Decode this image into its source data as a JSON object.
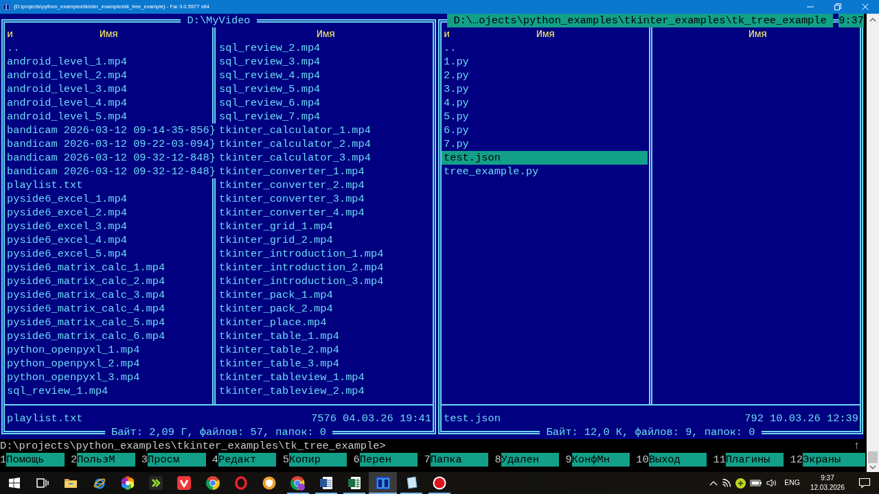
{
  "window": {
    "title": "{D:\\projects\\python_examples\\tkinter_examples\\tk_tree_example} - Far 3.0.5577 x64"
  },
  "panels": [
    {
      "title": "D:\\MyVideo",
      "active": false,
      "sort_indicator": "и",
      "column_headers": [
        "Имя",
        "Имя"
      ],
      "columns": [
        [
          {
            "name": "..",
            "selected": false
          },
          {
            "name": "android_level_1.mp4",
            "selected": false
          },
          {
            "name": "android_level_2.mp4",
            "selected": false
          },
          {
            "name": "android_level_3.mp4",
            "selected": false
          },
          {
            "name": "android_level_4.mp4",
            "selected": false
          },
          {
            "name": "android_level_5.mp4",
            "selected": false
          },
          {
            "name": "bandicam 2026-03-12 09-14-35-856}",
            "selected": false
          },
          {
            "name": "bandicam 2026-03-12 09-22-03-094}",
            "selected": false
          },
          {
            "name": "bandicam 2026-03-12 09-32-12-848}",
            "selected": false
          },
          {
            "name": "bandicam 2026-03-12 09-32-12-848}",
            "selected": false
          },
          {
            "name": "playlist.txt",
            "selected": false
          },
          {
            "name": "pyside6_excel_1.mp4",
            "selected": false
          },
          {
            "name": "pyside6_excel_2.mp4",
            "selected": false
          },
          {
            "name": "pyside6_excel_3.mp4",
            "selected": false
          },
          {
            "name": "pyside6_excel_4.mp4",
            "selected": false
          },
          {
            "name": "pyside6_excel_5.mp4",
            "selected": false
          },
          {
            "name": "pyside6_matrix_calc_1.mp4",
            "selected": false
          },
          {
            "name": "pyside6_matrix_calc_2.mp4",
            "selected": false
          },
          {
            "name": "pyside6_matrix_calc_3.mp4",
            "selected": false
          },
          {
            "name": "pyside6_matrix_calc_4.mp4",
            "selected": false
          },
          {
            "name": "pyside6_matrix_calc_5.mp4",
            "selected": false
          },
          {
            "name": "pyside6_matrix_calc_6.mp4",
            "selected": false
          },
          {
            "name": "python_openpyxl_1.mp4",
            "selected": false
          },
          {
            "name": "python_openpyxl_2.mp4",
            "selected": false
          },
          {
            "name": "python_openpyxl_3.mp4",
            "selected": false
          },
          {
            "name": "sql_review_1.mp4",
            "selected": false
          }
        ],
        [
          {
            "name": "sql_review_2.mp4",
            "selected": false
          },
          {
            "name": "sql_review_3.mp4",
            "selected": false
          },
          {
            "name": "sql_review_4.mp4",
            "selected": false
          },
          {
            "name": "sql_review_5.mp4",
            "selected": false
          },
          {
            "name": "sql_review_6.mp4",
            "selected": false
          },
          {
            "name": "sql_review_7.mp4",
            "selected": false
          },
          {
            "name": "tkinter_calculator_1.mp4",
            "selected": false
          },
          {
            "name": "tkinter_calculator_2.mp4",
            "selected": false
          },
          {
            "name": "tkinter_calculator_3.mp4",
            "selected": false
          },
          {
            "name": "tkinter_converter_1.mp4",
            "selected": false
          },
          {
            "name": "tkinter_converter_2.mp4",
            "selected": false
          },
          {
            "name": "tkinter_converter_3.mp4",
            "selected": false
          },
          {
            "name": "tkinter_converter_4.mp4",
            "selected": false
          },
          {
            "name": "tkinter_grid_1.mp4",
            "selected": false
          },
          {
            "name": "tkinter_grid_2.mp4",
            "selected": false
          },
          {
            "name": "tkinter_introduction_1.mp4",
            "selected": false
          },
          {
            "name": "tkinter_introduction_2.mp4",
            "selected": false
          },
          {
            "name": "tkinter_introduction_3.mp4",
            "selected": false
          },
          {
            "name": "tkinter_pack_1.mp4",
            "selected": false
          },
          {
            "name": "tkinter_pack_2.mp4",
            "selected": false
          },
          {
            "name": "tkinter_place.mp4",
            "selected": false
          },
          {
            "name": "tkinter_table_1.mp4",
            "selected": false
          },
          {
            "name": "tkinter_table_2.mp4",
            "selected": false
          },
          {
            "name": "tkinter_table_3.mp4",
            "selected": false
          },
          {
            "name": "tkinter_tableview_1.mp4",
            "selected": false
          },
          {
            "name": "tkinter_tableview_2.mp4",
            "selected": false
          }
        ]
      ],
      "info": {
        "name": "playlist.txt",
        "details": "7576 04.03.26 19:41"
      },
      "totals": "Байт: 2,09 Г, файлов: 57, папок: 0"
    },
    {
      "title": "D:\\…ojects\\python_examples\\tkinter_examples\\tk_tree_example",
      "active": true,
      "clock": "9:37",
      "sort_indicator": "и",
      "column_headers": [
        "Имя",
        "Имя"
      ],
      "columns": [
        [
          {
            "name": "..",
            "selected": false
          },
          {
            "name": "1.py",
            "selected": false
          },
          {
            "name": "2.py",
            "selected": false
          },
          {
            "name": "3.py",
            "selected": false
          },
          {
            "name": "4.py",
            "selected": false
          },
          {
            "name": "5.py",
            "selected": false
          },
          {
            "name": "6.py",
            "selected": false
          },
          {
            "name": "7.py",
            "selected": false
          },
          {
            "name": "test.json",
            "selected": true
          },
          {
            "name": "tree_example.py",
            "selected": false
          }
        ]
      ],
      "info": {
        "name": "test.json",
        "details": "792 10.03.26 12:39"
      },
      "totals": "Байт: 12,0 К, файлов: 9, папок: 0"
    }
  ],
  "command_line": {
    "text": "D:\\projects\\python_examples\\tkinter_examples\\tk_tree_example>",
    "scroll_marker": "↑"
  },
  "key_bar": [
    {
      "key": "1",
      "label": "Помощь"
    },
    {
      "key": "2",
      "label": "ПользМ"
    },
    {
      "key": "3",
      "label": "Просм"
    },
    {
      "key": "4",
      "label": "Редакт"
    },
    {
      "key": "5",
      "label": "Копир"
    },
    {
      "key": "6",
      "label": "Перен"
    },
    {
      "key": "7",
      "label": "Папка"
    },
    {
      "key": "8",
      "label": "Удален"
    },
    {
      "key": "9",
      "label": "КонфМн"
    },
    {
      "key": "10",
      "label": "Выход"
    },
    {
      "key": "11",
      "label": "Плагины"
    },
    {
      "key": "12",
      "label": "Экраны"
    }
  ],
  "taskbar": {
    "apps": [
      {
        "kind": "start",
        "running": false,
        "selected": false
      },
      {
        "kind": "task_view",
        "running": false,
        "selected": false
      },
      {
        "kind": "folder",
        "running": false,
        "selected": false
      },
      {
        "kind": "e_browser",
        "running": false,
        "selected": false
      },
      {
        "kind": "color_wheel",
        "running": false,
        "selected": false
      },
      {
        "kind": "app_tile",
        "running": false,
        "selected": false
      },
      {
        "kind": "v_tile",
        "running": false,
        "selected": false
      },
      {
        "kind": "color_ring",
        "running": false,
        "selected": false
      },
      {
        "kind": "o_ring",
        "running": false,
        "selected": false
      },
      {
        "kind": "shield_circle",
        "running": false,
        "selected": false
      },
      {
        "kind": "color_ring_badge",
        "running": true,
        "selected": false
      },
      {
        "kind": "document_tile",
        "running": true,
        "selected": false
      },
      {
        "kind": "sheet_tile",
        "running": true,
        "selected": false
      },
      {
        "kind": "panels",
        "running": true,
        "selected": true
      },
      {
        "kind": "notepad",
        "running": true,
        "selected": false
      },
      {
        "kind": "record",
        "running": true,
        "selected": false
      }
    ],
    "tray": {
      "language": "ENG",
      "time": "9:37",
      "date": "12.03.2026"
    }
  }
}
